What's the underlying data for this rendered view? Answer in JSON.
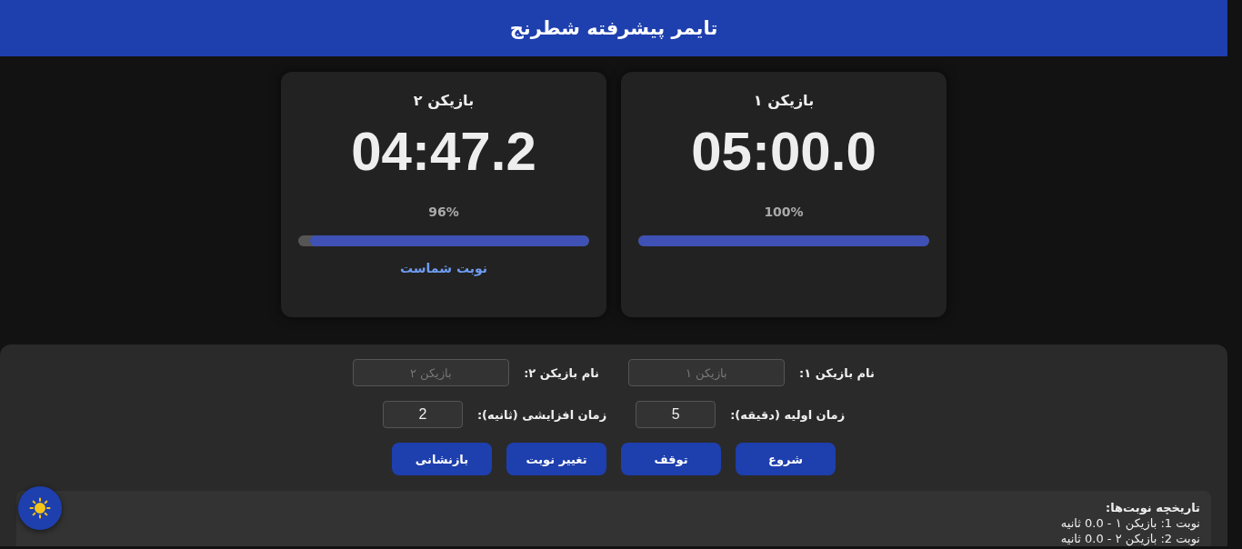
{
  "title": "تایمر پیشرفته شطرنج",
  "players": [
    {
      "name": "بازیکن ۱",
      "time": "05:00.0",
      "percent": "100%",
      "level": 1.0
    },
    {
      "name": "بازیکن ۲",
      "time": "04:47.2",
      "percent": "96%",
      "level": 0.96,
      "turn_label": "نوبت شماست"
    }
  ],
  "settings": [
    {
      "label": "نام بازیکن ۱:",
      "placeholder": "بازیکن ۱",
      "kind": "text"
    },
    {
      "label": "نام بازیکن ۲:",
      "placeholder": "بازیکن ۲",
      "kind": "text"
    },
    {
      "label": "زمان اولیه (دقیقه):",
      "value": "5",
      "kind": "number"
    },
    {
      "label": "زمان افزایشی (ثانیه):",
      "value": "2",
      "kind": "number"
    }
  ],
  "buttons": [
    "شروع",
    "توقف",
    "تغییر نوبت",
    "بازنشانی"
  ],
  "history": {
    "title": "تاریخچه نوبت‌ها:",
    "entries": [
      "نوبت 1: بازیکن ۱ - 0.0 ثانیه",
      "نوبت 2: بازیکن ۲ - 0.0 ثانیه"
    ]
  }
}
